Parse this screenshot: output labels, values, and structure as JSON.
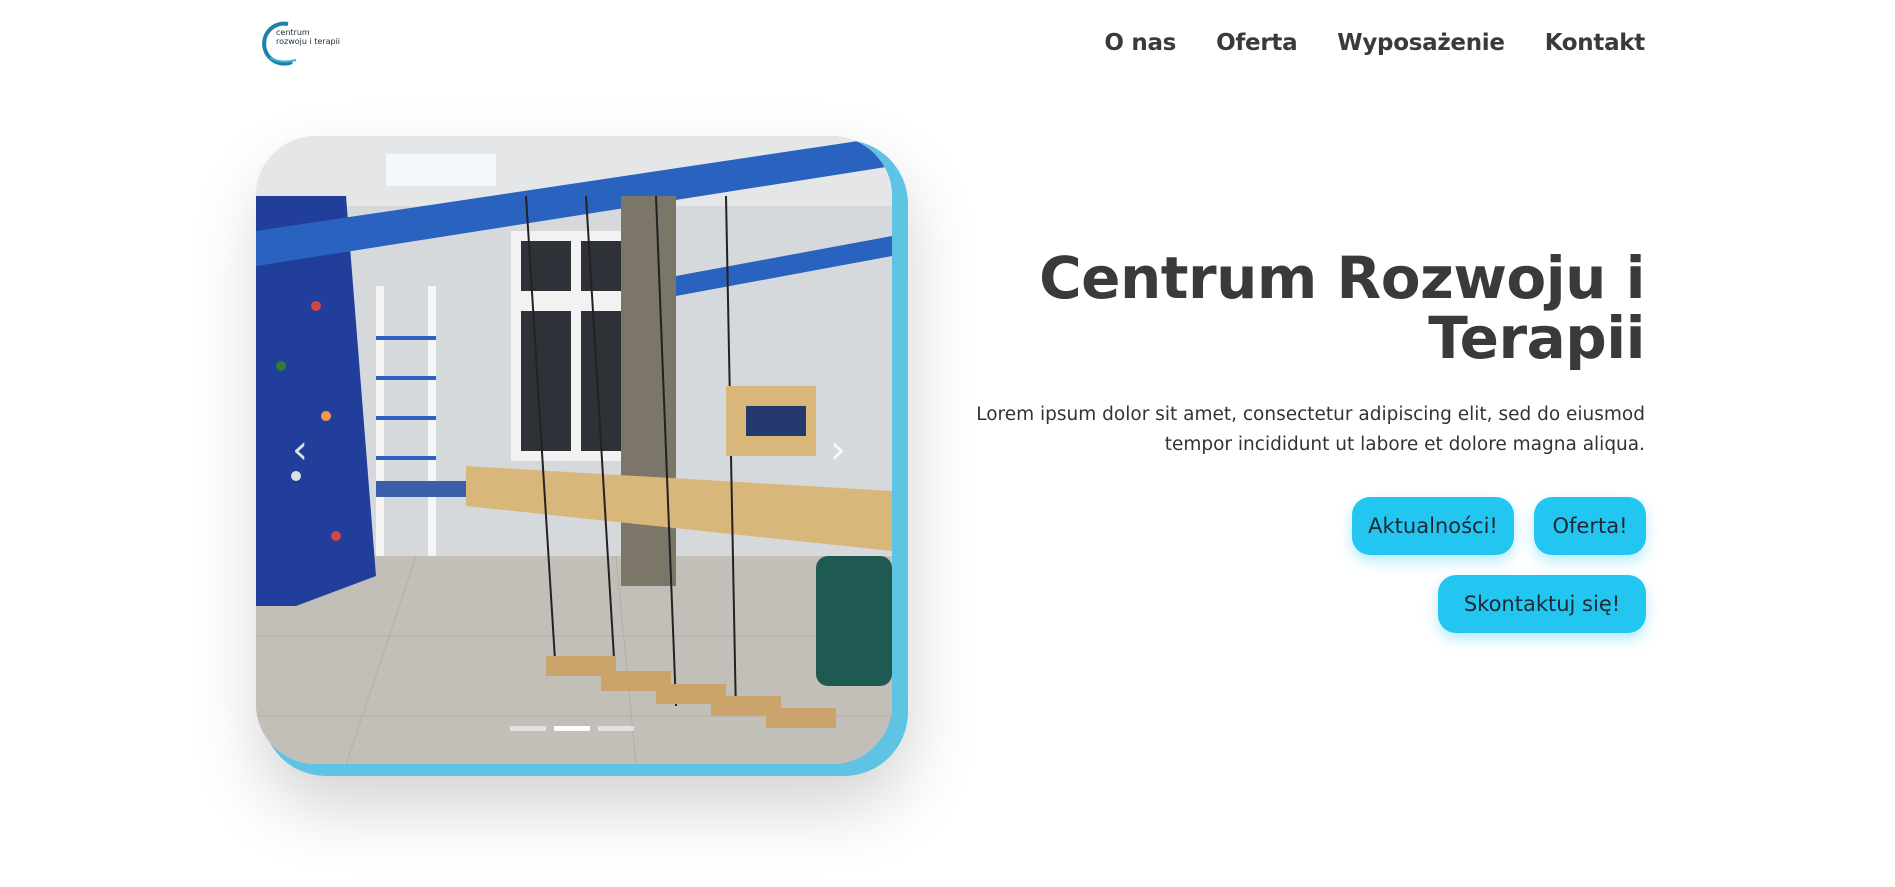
{
  "header": {
    "logo": {
      "line1": "centrum",
      "line2": "rozwoju i terapii",
      "color": "#1e7fa8"
    },
    "nav": [
      {
        "label": "O nas"
      },
      {
        "label": "Oferta"
      },
      {
        "label": "Wyposażenie"
      },
      {
        "label": "Kontakt"
      }
    ]
  },
  "carousel": {
    "prev_icon": "chevron-left-icon",
    "next_icon": "chevron-right-icon",
    "prev_glyph": "‹",
    "next_glyph": "›",
    "slides_count": 3,
    "active_slide": 2
  },
  "hero": {
    "title": "Centrum Rozwoju i Terapii",
    "text": "Lorem ipsum dolor sit amet, consectetur adipiscing elit, sed do eiusmod tempor incididunt ut labore et dolore magna aliqua.",
    "buttons": {
      "news": "Aktualności!",
      "offer": "Oferta!",
      "contact": "Skontaktuj się!"
    },
    "accent_color": "#22c6f0"
  }
}
